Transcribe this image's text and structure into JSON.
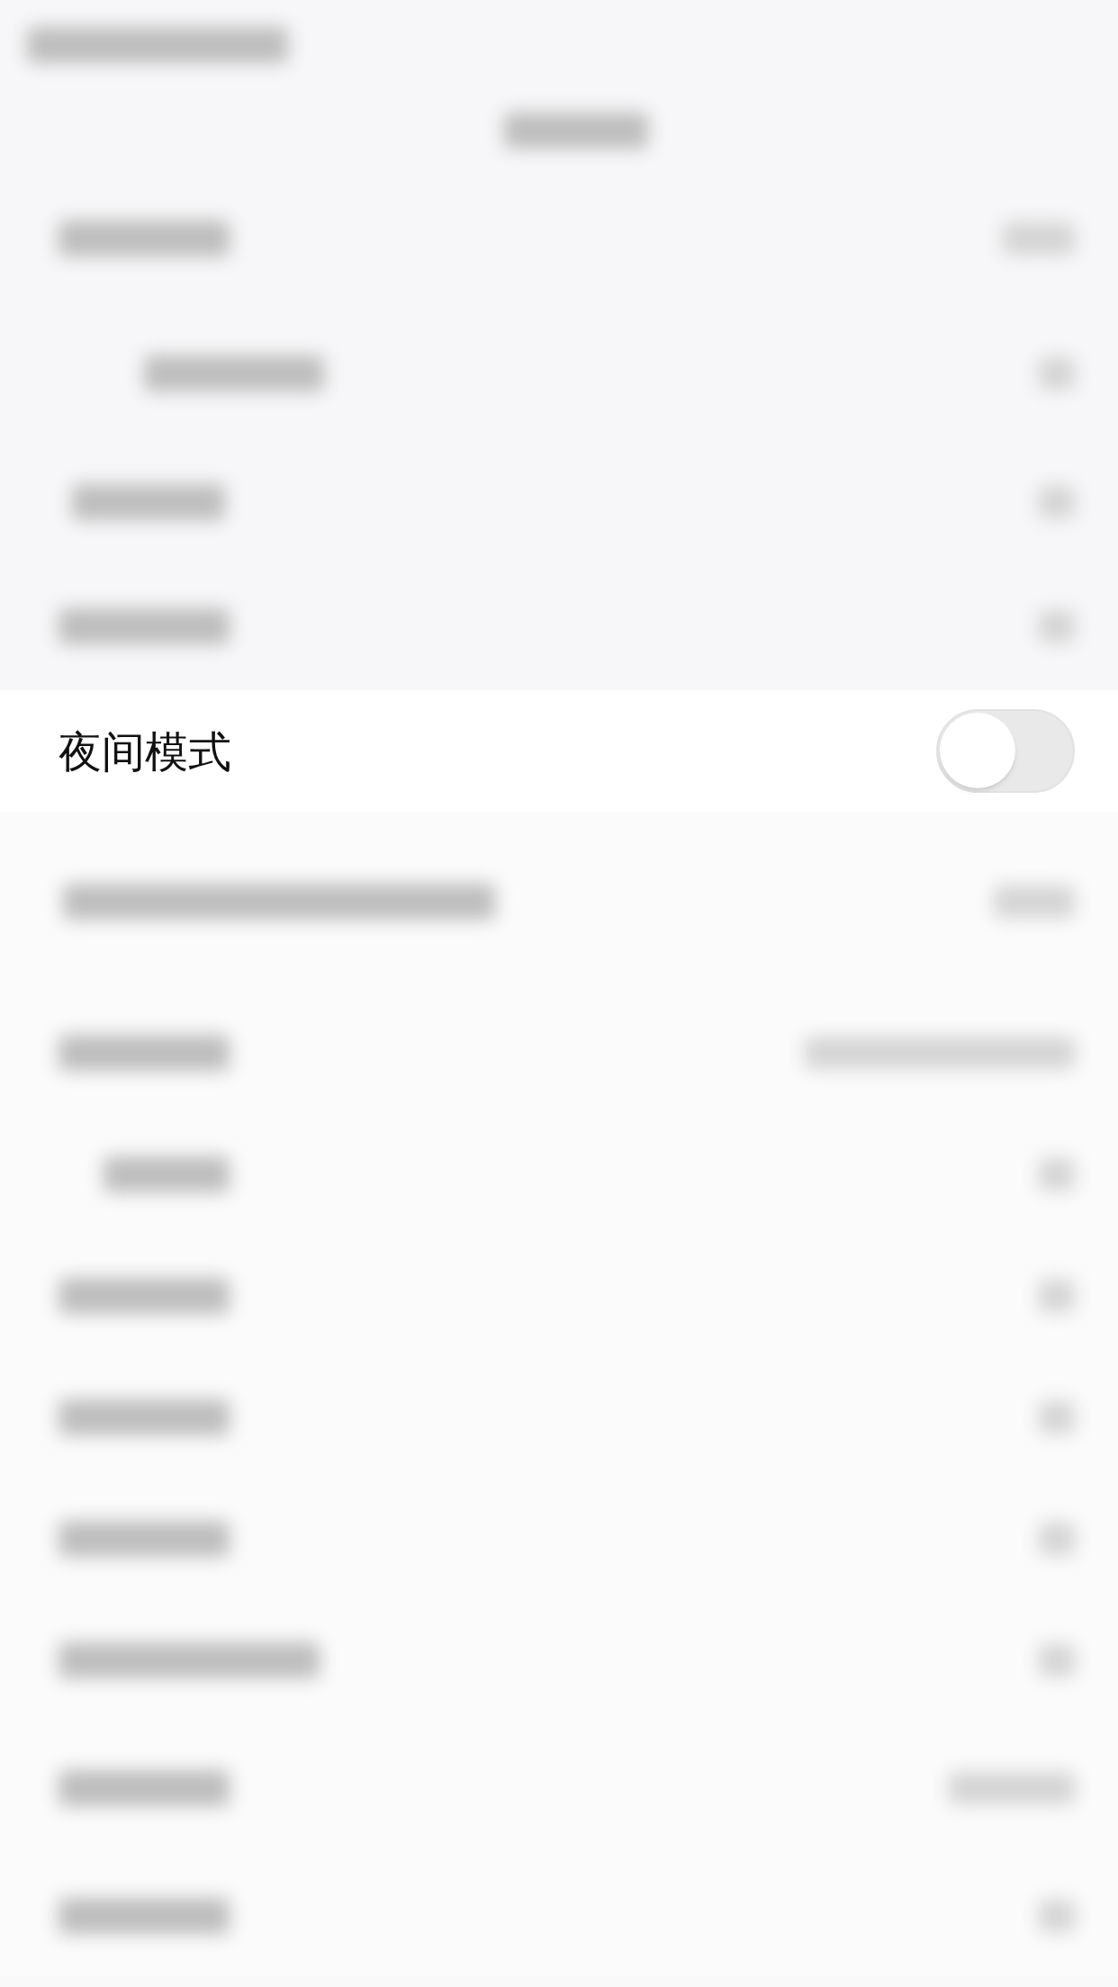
{
  "settings": [
    {
      "label": "夜间模式",
      "kind": "toggle",
      "on": false
    }
  ]
}
